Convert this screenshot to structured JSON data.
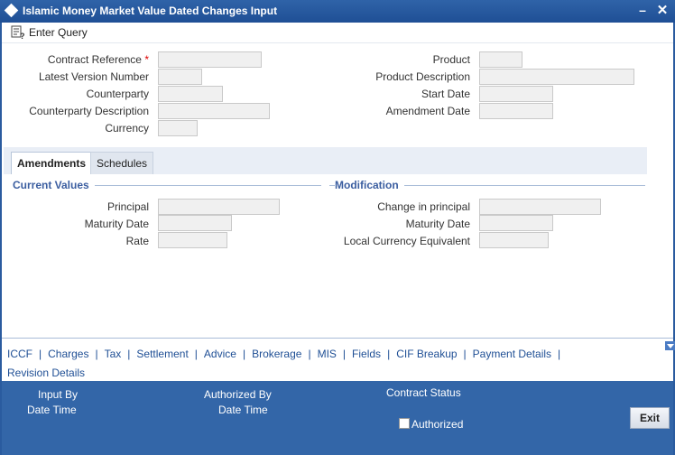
{
  "window": {
    "title": "Islamic Money Market Value Dated Changes Input",
    "minimize_glyph": "–",
    "close_glyph": "✕"
  },
  "toolbar": {
    "enter_query_label": "Enter Query",
    "icon": "enter-query-icon"
  },
  "header_left": {
    "contract_reference_label": "Contract Reference",
    "required_mark": "*",
    "latest_version_label": "Latest Version Number",
    "counterparty_label": "Counterparty",
    "counterparty_desc_label": "Counterparty Description",
    "currency_label": "Currency"
  },
  "header_right": {
    "product_label": "Product",
    "product_desc_label": "Product Description",
    "start_date_label": "Start Date",
    "amendment_date_label": "Amendment Date"
  },
  "tabs": [
    {
      "label": "Amendments",
      "active": true
    },
    {
      "label": "Schedules",
      "active": false
    }
  ],
  "current_values": {
    "heading": "Current Values",
    "principal_label": "Principal",
    "maturity_date_label": "Maturity Date",
    "rate_label": "Rate"
  },
  "modification": {
    "heading": "Modification",
    "change_principal_label": "Change in principal",
    "maturity_date_label": "Maturity Date",
    "lce_label": "Local Currency Equivalent"
  },
  "links": [
    "ICCF",
    "Charges",
    "Tax",
    "Settlement",
    "Advice",
    "Brokerage",
    "MIS",
    "Fields",
    "CIF Breakup",
    "Payment Details",
    "Revision Details"
  ],
  "footer": {
    "input_by_label": "Input By",
    "date_time_label": "Date Time",
    "authorized_by_label": "Authorized By",
    "date_time2_label": "Date Time",
    "contract_status_label": "Contract Status",
    "authorized_label": "Authorized",
    "exit_label": "Exit"
  },
  "colors": {
    "titlebar": "#1f4f95",
    "footer": "#3366a8",
    "link": "#1f4f95",
    "required": "#dd0000"
  }
}
